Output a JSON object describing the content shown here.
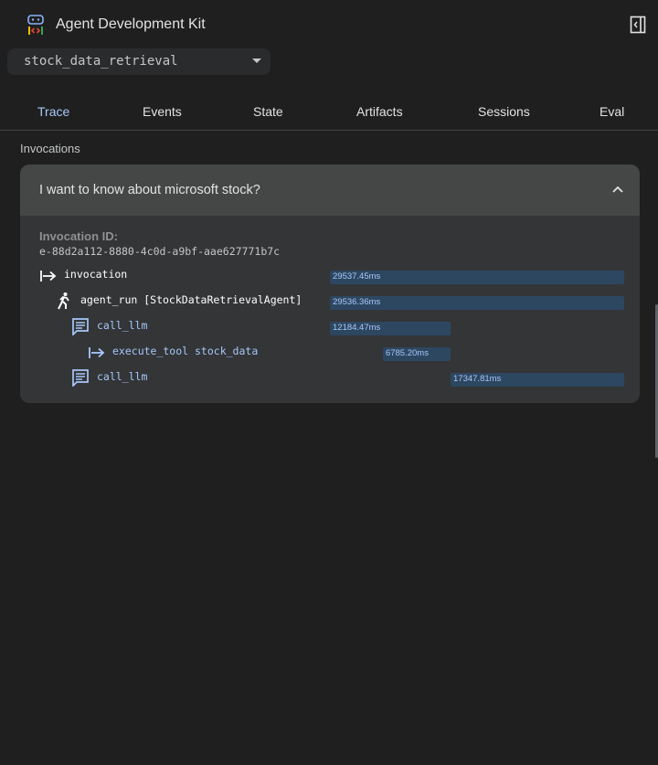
{
  "app": {
    "title": "Agent Development Kit"
  },
  "agent_selector": {
    "value": "stock_data_retrieval"
  },
  "tabs": [
    {
      "label": "Trace",
      "active": true
    },
    {
      "label": "Events",
      "active": false
    },
    {
      "label": "State",
      "active": false
    },
    {
      "label": "Artifacts",
      "active": false
    },
    {
      "label": "Sessions",
      "active": false
    },
    {
      "label": "Eval",
      "active": false
    }
  ],
  "section_label": "Invocations",
  "invocation": {
    "question": "I want to know about microsoft stock?",
    "id_label": "Invocation ID:",
    "id_value": "e-88d2a112-8880-4c0d-a9bf-aae627771b7c"
  },
  "trace": [
    {
      "name": "invocation",
      "icon": "arrow-right-to-line-icon",
      "duration": "29537.45ms",
      "start_fraction": 0.0,
      "width_fraction": 1.0
    },
    {
      "name": "agent_run [StockDataRetrievalAgent]",
      "icon": "running-person-icon",
      "duration": "29536.36ms",
      "start_fraction": 0.0,
      "width_fraction": 1.0
    },
    {
      "name": "call_llm",
      "icon": "chat-message-icon",
      "duration": "12184.47ms",
      "start_fraction": 0.0,
      "width_fraction": 0.41
    },
    {
      "name": "execute_tool stock_data",
      "icon": "arrow-right-to-line-icon",
      "duration": "6785.20ms",
      "start_fraction": 0.18,
      "width_fraction": 0.23
    },
    {
      "name": "call_llm",
      "icon": "chat-message-icon",
      "duration": "17347.81ms",
      "start_fraction": 0.41,
      "width_fraction": 0.59
    }
  ],
  "colors": {
    "background": "#1f1f1f",
    "panel": "#333537",
    "panel_header": "#444746",
    "accent": "#a8c7fa",
    "bar": "#2d4761"
  }
}
